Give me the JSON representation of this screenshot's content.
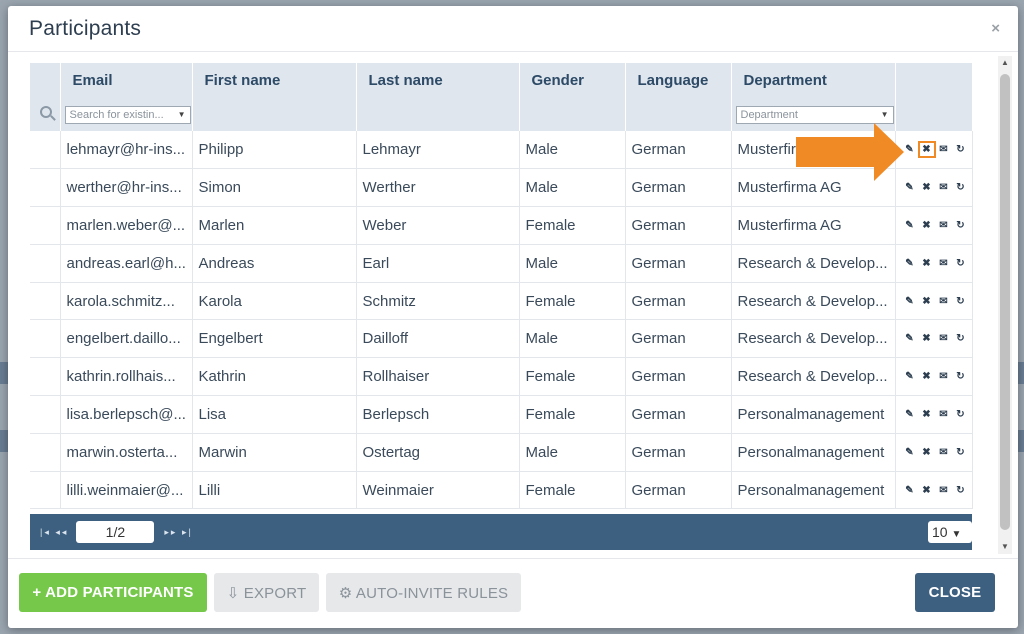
{
  "modal": {
    "title": "Participants",
    "close_glyph": "×"
  },
  "table": {
    "columns": [
      "Email",
      "First name",
      "Last name",
      "Gender",
      "Language",
      "Department"
    ],
    "filters": {
      "email_placeholder": "Search for existin...",
      "department_placeholder": "Department"
    },
    "rows": [
      {
        "email": "lehmayr@hr-ins...",
        "first": "Philipp",
        "last": "Lehmayr",
        "gender": "Male",
        "language": "German",
        "department": "Musterfir"
      },
      {
        "email": "werther@hr-ins...",
        "first": "Simon",
        "last": "Werther",
        "gender": "Male",
        "language": "German",
        "department": "Musterfirma AG"
      },
      {
        "email": "marlen.weber@...",
        "first": "Marlen",
        "last": "Weber",
        "gender": "Female",
        "language": "German",
        "department": "Musterfirma AG"
      },
      {
        "email": "andreas.earl@h...",
        "first": "Andreas",
        "last": "Earl",
        "gender": "Male",
        "language": "German",
        "department": "Research & Develop..."
      },
      {
        "email": "karola.schmitz...",
        "first": "Karola",
        "last": "Schmitz",
        "gender": "Female",
        "language": "German",
        "department": "Research & Develop..."
      },
      {
        "email": "engelbert.daillo...",
        "first": "Engelbert",
        "last": "Dailloff",
        "gender": "Male",
        "language": "German",
        "department": "Research & Develop..."
      },
      {
        "email": "kathrin.rollhais...",
        "first": "Kathrin",
        "last": "Rollhaiser",
        "gender": "Female",
        "language": "German",
        "department": "Research & Develop..."
      },
      {
        "email": "lisa.berlepsch@...",
        "first": "Lisa",
        "last": "Berlepsch",
        "gender": "Female",
        "language": "German",
        "department": "Personalmanagement"
      },
      {
        "email": "marwin.osterta...",
        "first": "Marwin",
        "last": "Ostertag",
        "gender": "Male",
        "language": "German",
        "department": "Personalmanagement"
      },
      {
        "email": "lilli.weinmaier@...",
        "first": "Lilli",
        "last": "Weinmaier",
        "gender": "Female",
        "language": "German",
        "department": "Personalmanagement"
      }
    ],
    "row_action_icons": [
      "pencil-icon",
      "delete-x-icon",
      "envelope-icon",
      "refresh-icon"
    ]
  },
  "pager": {
    "page": "1/2",
    "page_size": "10"
  },
  "footer": {
    "add_label": "+ ADD PARTICIPANTS",
    "export_label": "⇩ EXPORT",
    "rules_label": "⚙ AUTO-INVITE RULES",
    "close_label": "CLOSE"
  },
  "colors": {
    "accent_blue": "#3d5f80",
    "add_green": "#75c84a",
    "callout_orange": "#f08a24"
  }
}
